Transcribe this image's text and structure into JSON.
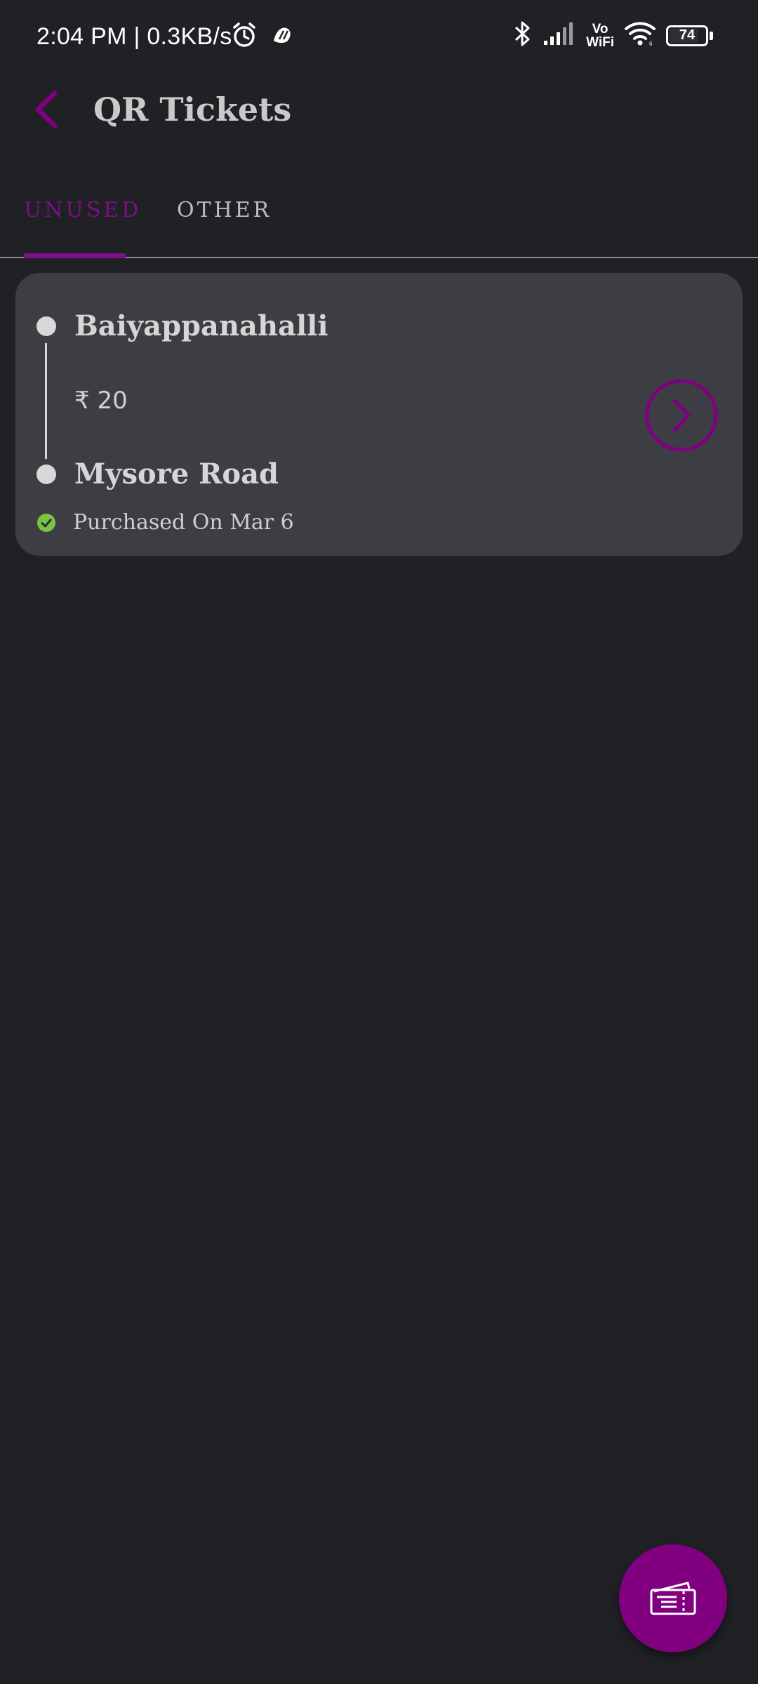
{
  "status_bar": {
    "time_speed": "2:04 PM | 0.3KB/s",
    "vowifi_top": "Vo",
    "vowifi_bottom": "WiFi",
    "battery_level": "74",
    "icons": [
      "alarm-icon",
      "app-notification-icon",
      "bluetooth-icon",
      "signal-icon",
      "wifi-icon",
      "battery-icon"
    ]
  },
  "header": {
    "title": "QR Tickets",
    "back_icon": "chevron-left-icon"
  },
  "tabs": {
    "items": [
      {
        "label": "UNUSED",
        "active": true
      },
      {
        "label": "OTHER",
        "active": false
      }
    ]
  },
  "ticket": {
    "from": "Baiyappanahalli",
    "to": "Mysore Road",
    "fare": "₹ 20",
    "purchased": "Purchased On Mar 6",
    "status_icon": "check-circle-icon",
    "open_icon": "chevron-right-circle-icon"
  },
  "fab": {
    "icon": "ticket-icon"
  },
  "colors": {
    "background": "#202125",
    "card": "#3c3e43",
    "accent": "#800080",
    "success": "#7cc243"
  }
}
